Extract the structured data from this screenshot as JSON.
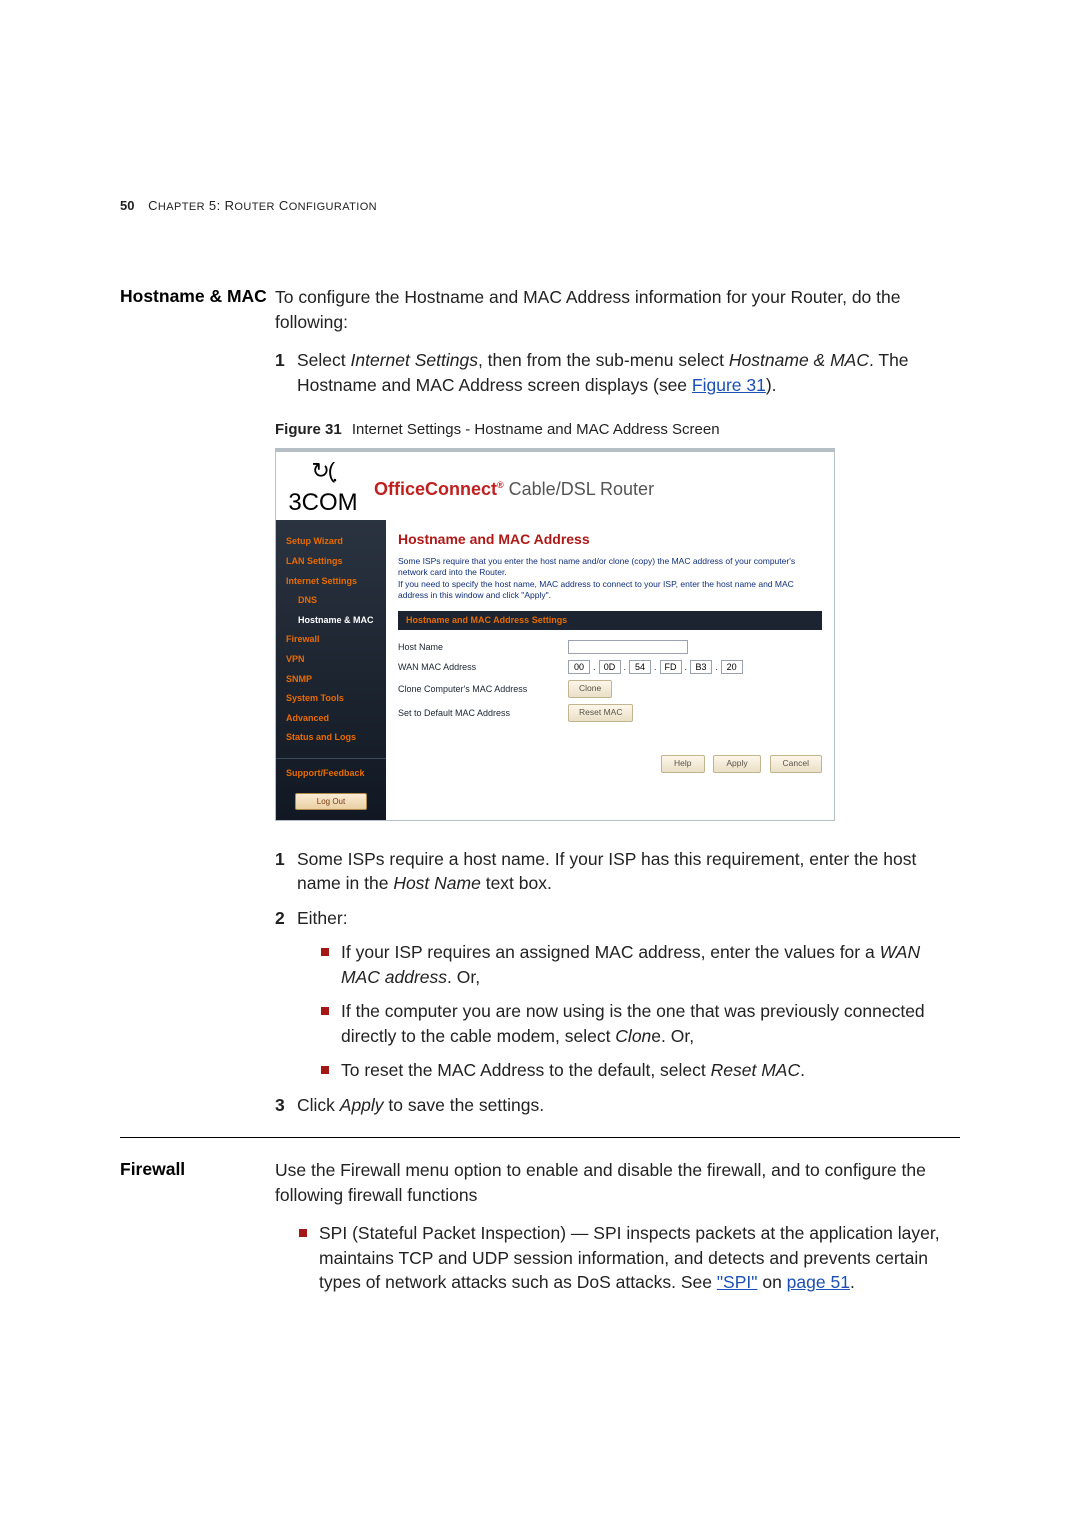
{
  "header": {
    "page_number": "50",
    "chapter_prefix": "C",
    "chapter_word": "HAPTER",
    "chapter_num": " 5: R",
    "chapter_rest": "OUTER",
    "chapter_tail_prefix": " C",
    "chapter_tail": "ONFIGURATION"
  },
  "section1": {
    "side_heading": "Hostname & MAC",
    "intro": "To configure the Hostname and MAC Address information for your Router, do the following:",
    "step1_a": "Select ",
    "step1_em1": "Internet Settings",
    "step1_b": ", then from the sub-menu select ",
    "step1_em2": "Hostname & MAC",
    "step1_c": ". The Hostname and MAC Address screen displays (see ",
    "step1_link": "Figure 31",
    "step1_d": ").",
    "fig_label": "Figure 31",
    "fig_caption": "Internet Settings - Hostname and MAC Address Screen",
    "router": {
      "brand_swirl": "↻◌",
      "brand_word": "3COM",
      "title_oc": "OfficeConnect",
      "title_rest": " Cable/DSL Router",
      "nav": [
        "Setup Wizard",
        "LAN Settings",
        "Internet Settings",
        "DNS",
        "Hostname & MAC",
        "Firewall",
        "VPN",
        "SNMP",
        "System Tools",
        "Advanced",
        "Status and Logs",
        "Support/Feedback"
      ],
      "logout": "Log Out",
      "panel_title": "Hostname and MAC Address",
      "panel_intro": "Some ISPs require that you enter the host name and/or clone (copy) the MAC address of your computer's network card into the Router.\nIf you need to specify the host name, MAC address to connect to your ISP, enter the host name and MAC address in this window and click \"Apply\".",
      "settings_bar": "Hostname and MAC Address Settings",
      "row_host": "Host Name",
      "row_wan": "WAN MAC Address",
      "mac": [
        "00",
        "0D",
        "54",
        "FD",
        "B3",
        "20"
      ],
      "row_clone": "Clone Computer's MAC Address",
      "btn_clone": "Clone",
      "row_reset": "Set to Default MAC Address",
      "btn_reset": "Reset MAC",
      "btn_help": "Help",
      "btn_apply": "Apply",
      "btn_cancel": "Cancel"
    },
    "below_step1_a": "Some ISPs require a host name. If your ISP has this requirement, enter the host name in the ",
    "below_step1_em": "Host Name",
    "below_step1_b": " text box.",
    "below_step2": "Either:",
    "bullet1_a": "If your ISP requires an assigned MAC address, enter the values for a ",
    "bullet1_em": "WAN MAC address",
    "bullet1_b": ". Or,",
    "bullet2_a": "If the computer you are now using is the one that was previously connected directly to the cable modem, select ",
    "bullet2_em": "Clon",
    "bullet2_b": "e. Or,",
    "bullet3_a": "To reset the MAC Address to the default, select ",
    "bullet3_em": "Reset MAC",
    "bullet3_b": ".",
    "below_step3_a": "Click ",
    "below_step3_em": "Apply",
    "below_step3_b": " to save the settings."
  },
  "section2": {
    "side_heading": "Firewall",
    "intro": "Use the Firewall menu option to enable and disable the firewall, and to configure the following firewall functions",
    "bullet1_a": "SPI (Stateful Packet Inspection) — SPI inspects packets at the application layer, maintains TCP and UDP session information, and detects and prevents certain types of network attacks such as DoS attacks. See ",
    "bullet1_link1": "\"SPI\"",
    "bullet1_mid": " on ",
    "bullet1_link2": "page 51",
    "bullet1_b": "."
  }
}
